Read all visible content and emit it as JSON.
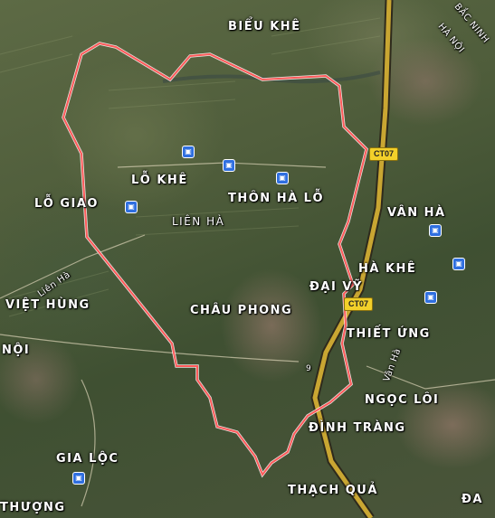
{
  "map": {
    "boundary_color": "#ff5a5a",
    "highway_color": "#c9a632",
    "labels": {
      "bieu_khe": "BIỂU KHÊ",
      "bac_ninh": "BẮC NINH",
      "ha_noi": "HÀ NỘI",
      "lo_khe": "LỖ KHÊ",
      "lo_giao": "LỖ GIAO",
      "thon_ha_lo": "THÔN HÀ LỖ",
      "lien_ha": "LIÊN HÀ",
      "van_ha": "VÂN HÀ",
      "ha_khe": "HÀ KHÊ",
      "dai_vi": "ĐẠI VỸ",
      "chau_phong": "CHÂU PHONG",
      "lien_ha_road": "Liên Hà",
      "viet_hung": "VIỆT HÙNG",
      "noi": "NỘI",
      "thiet_ung": "THIẾT ỨNG",
      "van_ha_road": "Vân Hà",
      "ngoc_loi": "NGỌC LÔI",
      "dinh_trang": "ĐÌNH TRÀNG",
      "gia_loc": "GIA LỘC",
      "thuong": "THƯỢNG",
      "thach_qua": "THẠCH QUẢ",
      "da": "ĐA"
    },
    "road_shields": {
      "ct07_top": "CT07",
      "ct07_mid": "CT07"
    },
    "road_number": "9",
    "bus_icon": "bus-stop-icon",
    "bus_glyph": "▣"
  }
}
